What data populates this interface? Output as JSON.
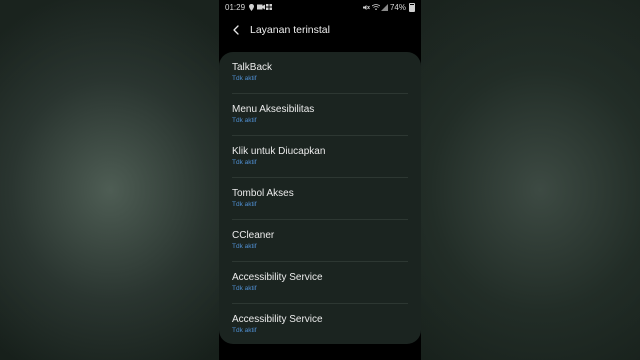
{
  "status_bar": {
    "time": "01:29",
    "battery": "74%",
    "left_icons": [
      "location-pin-icon",
      "video-icon",
      "grid-icon"
    ],
    "right_icons": [
      "mute-icon",
      "wifi-icon",
      "signal-icon",
      "battery-icon"
    ]
  },
  "header": {
    "back_icon": "chevron-left-icon",
    "title": "Layanan terinstal"
  },
  "services": [
    {
      "title": "TalkBack",
      "status": "Tdk aktif"
    },
    {
      "title": "Menu Aksesibilitas",
      "status": "Tdk aktif"
    },
    {
      "title": "Klik untuk Diucapkan",
      "status": "Tdk aktif"
    },
    {
      "title": "Tombol Akses",
      "status": "Tdk aktif"
    },
    {
      "title": "CCleaner",
      "status": "Tdk aktif"
    },
    {
      "title": "Accessibility Service",
      "status": "Tdk aktif"
    },
    {
      "title": "Accessibility Service",
      "status": "Tdk aktif"
    }
  ],
  "colors": {
    "status_text": "#4f8ed1",
    "card_bg": "#1b2420"
  }
}
